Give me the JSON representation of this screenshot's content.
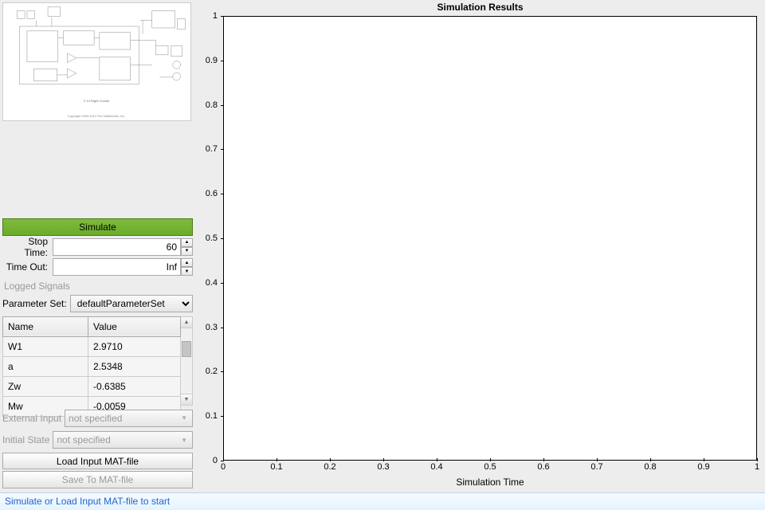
{
  "plot": {
    "title": "Simulation Results",
    "xlabel": "Simulation Time",
    "yticks": [
      "0",
      "0.1",
      "0.2",
      "0.3",
      "0.4",
      "0.5",
      "0.6",
      "0.7",
      "0.8",
      "0.9",
      "1"
    ],
    "xticks": [
      "0",
      "0.1",
      "0.2",
      "0.3",
      "0.4",
      "0.5",
      "0.6",
      "0.7",
      "0.8",
      "0.9",
      "1"
    ]
  },
  "left": {
    "simulate_label": "Simulate",
    "stop_time_label": "Stop Time:",
    "stop_time_value": "60",
    "time_out_label": "Time Out:",
    "time_out_value": "Inf",
    "logged_signals_label": "Logged Signals",
    "param_set_label": "Parameter Set:",
    "param_set_value": "defaultParameterSet",
    "table": {
      "col_name": "Name",
      "col_value": "Value",
      "rows": [
        {
          "name": "W1",
          "value": "2.9710"
        },
        {
          "name": "a",
          "value": "2.5348"
        },
        {
          "name": "Zw",
          "value": "-0.6385"
        },
        {
          "name": "Mw",
          "value": "-0.0059"
        }
      ]
    },
    "external_input_label": "External Input",
    "external_input_value": "not specified",
    "initial_state_label": "Initial State",
    "initial_state_value": "not specified",
    "load_mat_label": "Load Input MAT-file",
    "save_mat_label": "Save To MAT-file"
  },
  "thumbnail": {
    "caption1": "F-14 Flight Control",
    "caption2": "Copyright 1990-2014 The MathWorks, Inc."
  },
  "status": {
    "message": "Simulate or Load Input MAT-file to start"
  },
  "chart_data": {
    "type": "line",
    "title": "Simulation Results",
    "xlabel": "Simulation Time",
    "ylabel": "",
    "xlim": [
      0,
      1
    ],
    "ylim": [
      0,
      1
    ],
    "series": []
  }
}
